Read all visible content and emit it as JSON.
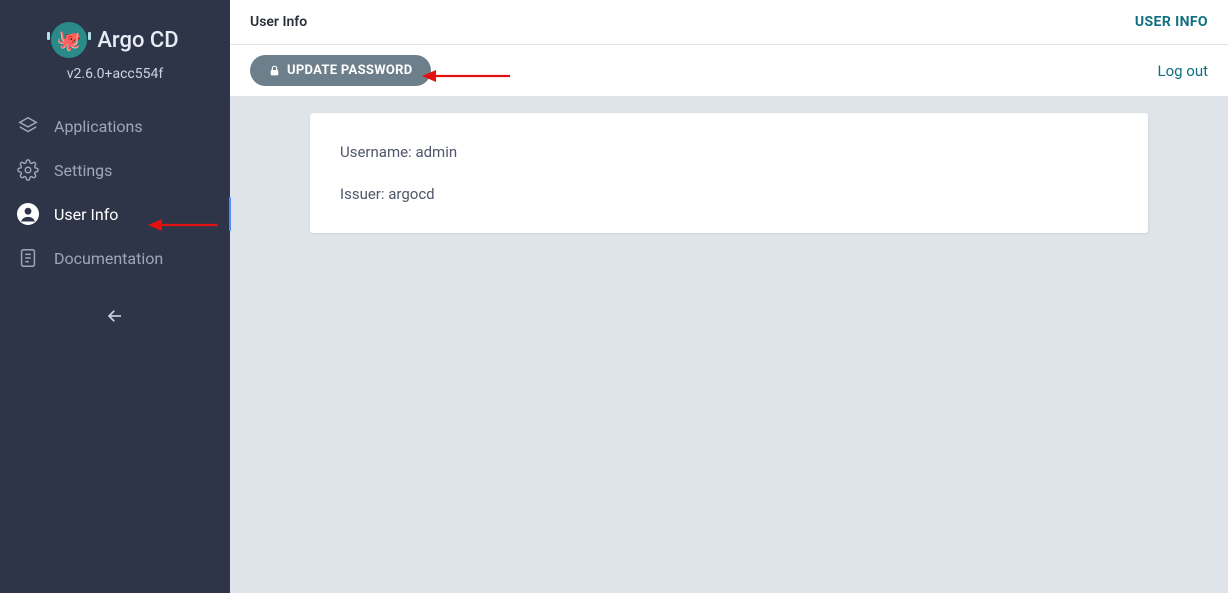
{
  "brand": {
    "name": "Argo CD",
    "version": "v2.6.0+acc554f"
  },
  "sidebar": {
    "items": [
      {
        "label": "Applications",
        "icon": "layers-icon",
        "active": false
      },
      {
        "label": "Settings",
        "icon": "gear-icon",
        "active": false
      },
      {
        "label": "User Info",
        "icon": "user-circle-icon",
        "active": true
      },
      {
        "label": "Documentation",
        "icon": "book-icon",
        "active": false
      }
    ]
  },
  "header": {
    "title": "User Info",
    "breadcrumb_right": "USER INFO"
  },
  "toolbar": {
    "update_password_label": "UPDATE PASSWORD",
    "logout_label": "Log out"
  },
  "user_card": {
    "username_label": "Username:",
    "username_value": "admin",
    "issuer_label": "Issuer:",
    "issuer_value": "argocd"
  },
  "annotation": {
    "arrow_color": "#e11111"
  }
}
